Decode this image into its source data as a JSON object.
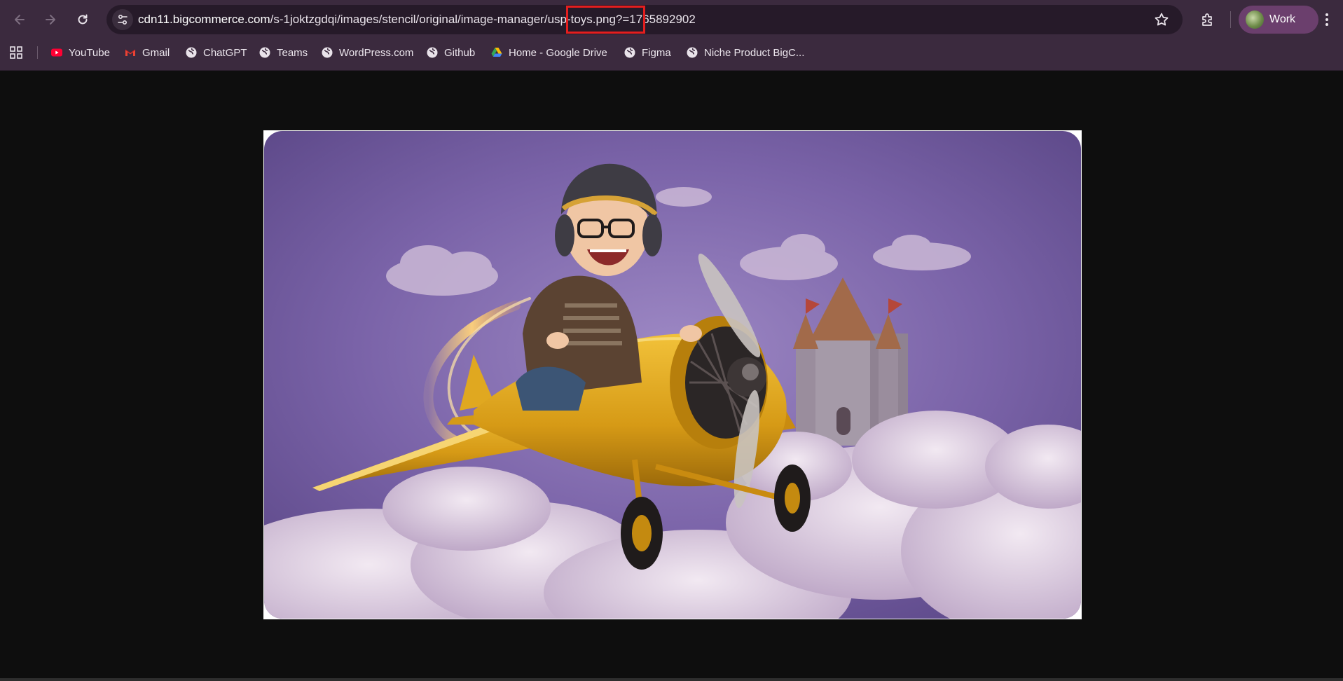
{
  "browser": {
    "nav": {
      "back_icon": "arrow-left-icon",
      "forward_icon": "arrow-right-icon",
      "reload_icon": "reload-icon"
    },
    "omnibox": {
      "host": "cdn11.bigcommerce.com",
      "path": "/s-1joktzgdqi/images/stencil/original/image-manager/usp-toys.png?t=1765892902",
      "path_before": "/s-1joktzgdqi/images/stencil/original/image-manager/",
      "path_highlighted": "usp-toys.png?",
      "path_after": "=1765892902"
    },
    "profile": {
      "label": "Work"
    },
    "bookmarks": [
      {
        "label": "YouTube",
        "icon": "youtube-icon"
      },
      {
        "label": "Gmail",
        "icon": "gmail-icon"
      },
      {
        "label": "ChatGPT",
        "icon": "globe-icon"
      },
      {
        "label": "Teams",
        "icon": "globe-icon"
      },
      {
        "label": "WordPress.com",
        "icon": "globe-icon"
      },
      {
        "label": "Github",
        "icon": "globe-icon"
      },
      {
        "label": "Home - Google Drive",
        "icon": "google-drive-icon"
      },
      {
        "label": "Figma",
        "icon": "globe-icon"
      },
      {
        "label": "Niche Product BigC...",
        "icon": "globe-icon"
      }
    ]
  },
  "colors": {
    "chrome_bg": "#3b2a3e",
    "omnibox_bg": "#261a29",
    "profile_bg": "#6b3f6d",
    "highlight": "#e41e1e",
    "page_bg": "#0e0e0e"
  },
  "content": {
    "image_subject": "child-pilot-yellow-toy-airplane-illustration"
  }
}
